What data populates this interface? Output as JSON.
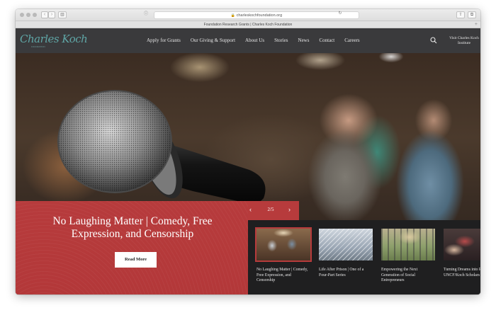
{
  "browser": {
    "url": "charleskochfoundation.org",
    "tab_title": "Foundation Research Grants | Charles Koch Foundation",
    "back_glyph": "‹",
    "forward_glyph": "›",
    "sidebar_glyph": "▥",
    "reader_glyph": "ⓘ",
    "reload_glyph": "↻",
    "share_glyph": "⇧",
    "tabs_glyph": "⧉",
    "new_tab_glyph": "+"
  },
  "header": {
    "logo_text": "Charles Koch",
    "logo_subtext": "FOUNDATION",
    "nav": [
      "Apply for Grants",
      "Our Giving & Support",
      "About Us",
      "Stories",
      "News",
      "Contact",
      "Careers"
    ],
    "visit_label": "Visit Charles Koch Institute",
    "icons": {
      "search": "search-icon"
    }
  },
  "hero": {
    "title": "No Laughing Matter | Comedy, Free Expression, and Censorship",
    "read_more": "Read More",
    "counter": "2/5",
    "prev_glyph": "‹",
    "next_glyph": "›",
    "accent_color": "#b73b3c",
    "dark_color": "#1f1f20"
  },
  "cards": [
    {
      "title": "No Laughing Matter | Comedy, Free Expression, and Censorship",
      "active": true
    },
    {
      "title": "Life After Prison | One of a Four-Part Series",
      "active": false
    },
    {
      "title": "Empowering the Next Generation of Social Entrepreneurs",
      "active": false
    },
    {
      "title": "Turning Dreams into Reality: UNCF/Koch Scholars",
      "active": false
    }
  ]
}
